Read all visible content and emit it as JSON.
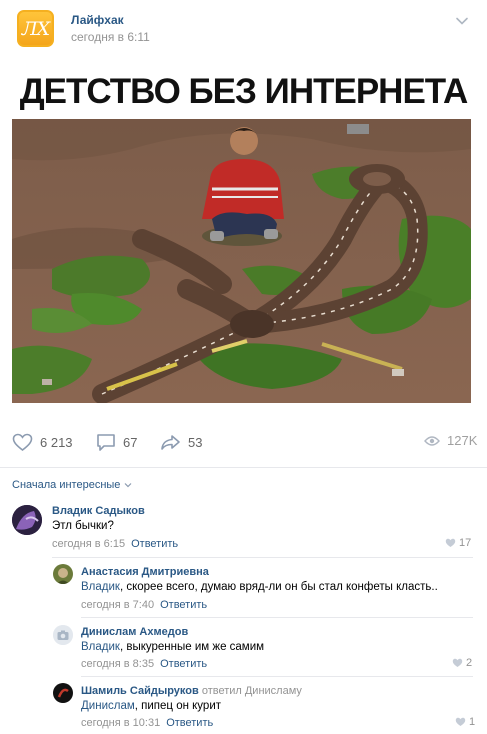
{
  "post": {
    "avatar_letters": "ЛХ",
    "author": "Лайфхак",
    "time": "сегодня в 6:11",
    "title": "ДЕТСТВО БЕЗ ИНТЕРНЕТА"
  },
  "actions": {
    "likes": "6 213",
    "comments": "67",
    "shares": "53",
    "views": "127K"
  },
  "comments_sort": "Сначала интересные",
  "comments": [
    {
      "name": "Владик Садыков",
      "text": "Этл бычки?",
      "time": "сегодня в 6:15",
      "reply_label": "Ответить",
      "likes": "17"
    },
    {
      "name": "Анастасия Дмитриевна",
      "addressee": "Владик",
      "text": ", скорее всего, думаю вряд-ли он бы стал конфеты класть..",
      "time": "сегодня в 7:40",
      "reply_label": "Ответить"
    },
    {
      "name": "Динислам Ахмедов",
      "addressee": "Владик",
      "text": ", выкуренные им же самим",
      "time": "сегодня в 8:35",
      "reply_label": "Ответить",
      "likes": "2"
    },
    {
      "name": "Шамиль Сайдыруков",
      "reply_to": "ответил Динисламу",
      "addressee": "Динислам",
      "text": ", пипец он курит",
      "time": "сегодня в 10:31",
      "reply_label": "Ответить",
      "likes": "1"
    }
  ],
  "colors": {
    "link": "#2a5885",
    "muted": "#939393",
    "avatar_orange": "#f4a51b"
  }
}
